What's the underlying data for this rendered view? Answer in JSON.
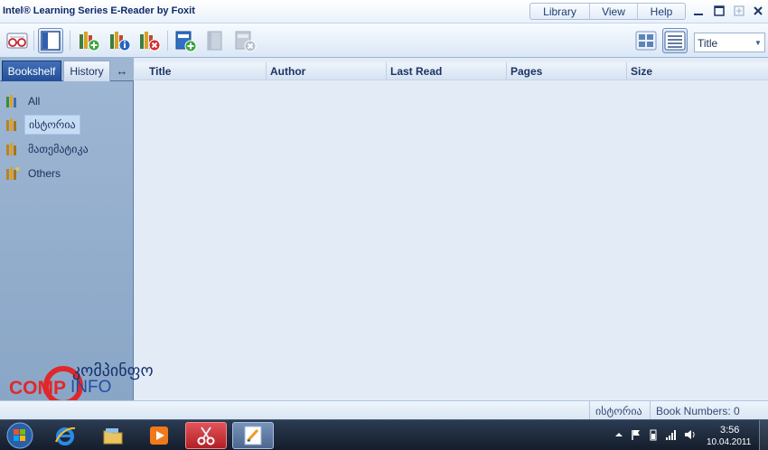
{
  "window": {
    "title": "Intel® Learning Series E-Reader by Foxit"
  },
  "menu": {
    "items": [
      "Library",
      "View",
      "Help"
    ]
  },
  "toolbar": {
    "sort_value": "Title"
  },
  "sidebar": {
    "tabs": {
      "bookshelf": "Bookshelf",
      "history": "History",
      "swap": "↔"
    },
    "items": [
      {
        "label": "All"
      },
      {
        "label": "ისტორია",
        "selected": true
      },
      {
        "label": "მათემატიკა"
      },
      {
        "label": "Others"
      }
    ]
  },
  "table": {
    "columns": [
      "Title",
      "Author",
      "Last Read",
      "Pages",
      "Size"
    ]
  },
  "watermark": {
    "text_top": "კომპინფო",
    "text_left": "COMP",
    "text_right": "INFO"
  },
  "status": {
    "shelf": "ისტორია",
    "book_numbers": "Book Numbers: 0"
  },
  "taskbar": {
    "time": "3:56",
    "date": "10.04.2011"
  },
  "colors": {
    "accent": "#234f99",
    "panel": "#9eb7d4",
    "main_bg": "#e3ecf6",
    "logo_red": "#e0282c",
    "logo_blue": "#1e4fa6"
  }
}
